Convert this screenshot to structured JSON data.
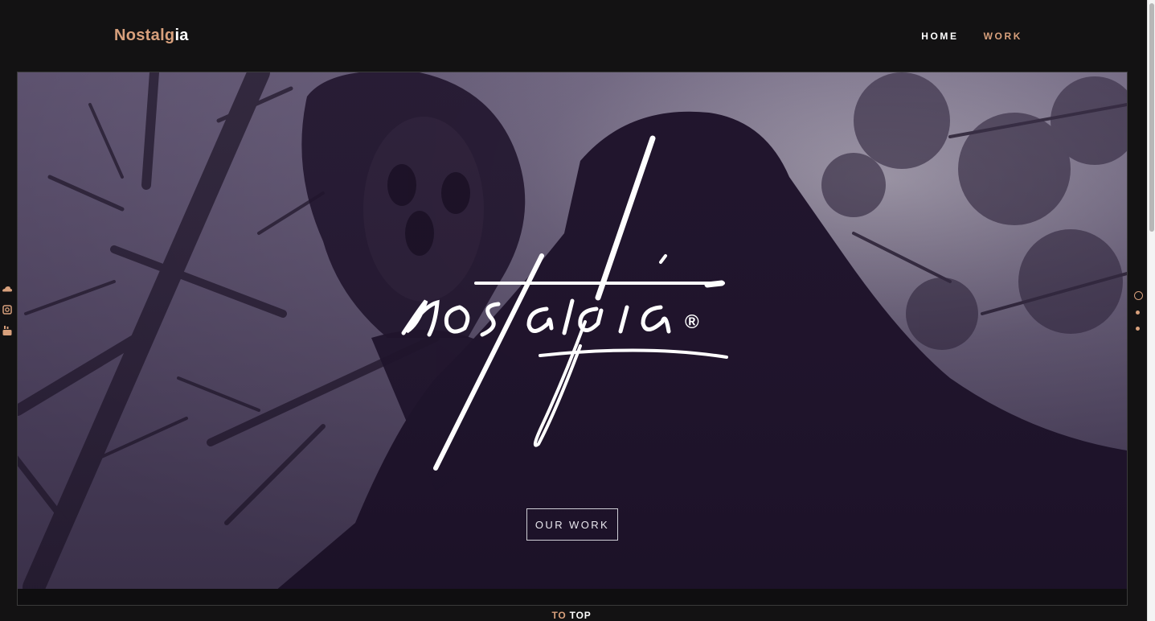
{
  "header": {
    "logo_part1": "Nostalg",
    "logo_part2": "ia",
    "nav": {
      "home": "HOME",
      "work": "WORK"
    }
  },
  "hero": {
    "wordmark": "nostalgia",
    "registered_mark": "®",
    "cta_label": "OUR WORK"
  },
  "social": [
    "soundcloud-icon",
    "instagram-icon",
    "youtube-icon"
  ],
  "section_dots": {
    "count": 3,
    "active_index": 0
  },
  "footer": {
    "to_label": "TO",
    "top_label": "TOP"
  },
  "colors": {
    "background": "#131213",
    "accent": "#d8a07c",
    "text": "#ffffff",
    "hero_tint": "#2a1c3a"
  }
}
